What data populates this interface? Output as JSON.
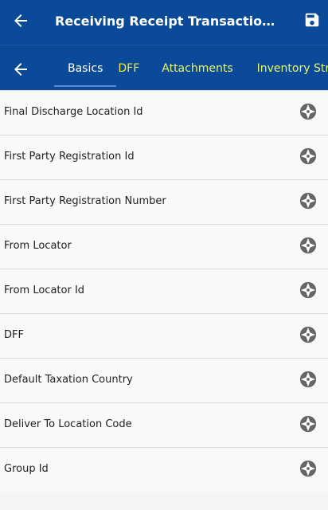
{
  "header": {
    "title": "Receiving Receipt Transaction ...",
    "back_icon": "arrow-left-icon",
    "save_icon": "save-icon"
  },
  "tabbar": {
    "back_icon": "arrow-left-icon",
    "tabs": [
      {
        "label": "Basics",
        "active": true
      },
      {
        "label": "DFF",
        "active": false
      },
      {
        "label": "Attachments",
        "active": false
      },
      {
        "label": "Inventory Str",
        "active": false
      }
    ]
  },
  "fields": [
    {
      "label": "Final Discharge Location Id",
      "icon": "aperture-icon"
    },
    {
      "label": "First Party Registration Id",
      "icon": "aperture-icon"
    },
    {
      "label": "First Party Registration Number",
      "icon": "aperture-icon"
    },
    {
      "label": "From Locator",
      "icon": "aperture-icon"
    },
    {
      "label": "From Locator Id",
      "icon": "aperture-icon"
    },
    {
      "label": "DFF",
      "icon": "aperture-icon"
    },
    {
      "label": "Default Taxation Country",
      "icon": "aperture-icon"
    },
    {
      "label": "Deliver To Location Code",
      "icon": "aperture-icon"
    },
    {
      "label": "Group Id",
      "icon": "aperture-icon"
    }
  ],
  "colors": {
    "header_bg": "#0b4a98",
    "active_tab_text": "#ffffff",
    "inactive_tab_text": "#e7f46f",
    "row_text": "#222222",
    "icon_gray": "#666666"
  }
}
